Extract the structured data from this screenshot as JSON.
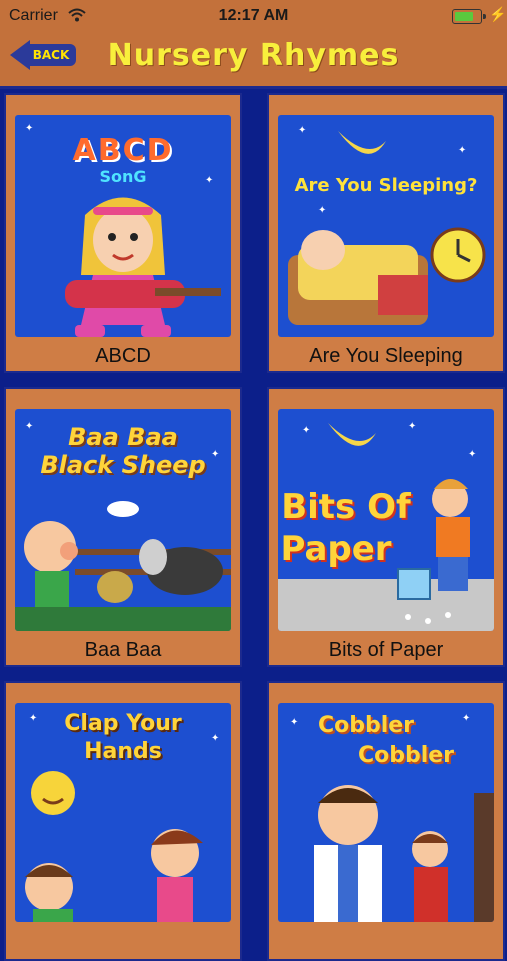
{
  "status_bar": {
    "carrier": "Carrier",
    "time": "12:17 AM",
    "battery_level": 0.7
  },
  "nav": {
    "back_label": "BACK",
    "title": "Nursery Rhymes"
  },
  "tiles": [
    {
      "caption": "ABCD",
      "art_title": "ABCD",
      "art_subtitle": "SonG"
    },
    {
      "caption": "Are You Sleeping",
      "art_title": "Are You Sleeping?"
    },
    {
      "caption": "Baa Baa",
      "art_title": "Baa Baa",
      "art_subtitle": "Black Sheep"
    },
    {
      "caption": "Bits of Paper",
      "art_title": "Bits Of",
      "art_subtitle": "Paper"
    },
    {
      "caption": "",
      "art_title": "Clap Your",
      "art_subtitle": "Hands"
    },
    {
      "caption": "",
      "art_title": "Cobbler",
      "art_subtitle": "Cobbler"
    }
  ],
  "colors": {
    "bar": "#c3713b",
    "tile_frame": "#cf7d45",
    "background": "#0c1f8a",
    "title_yellow": "#f8ef3c"
  }
}
